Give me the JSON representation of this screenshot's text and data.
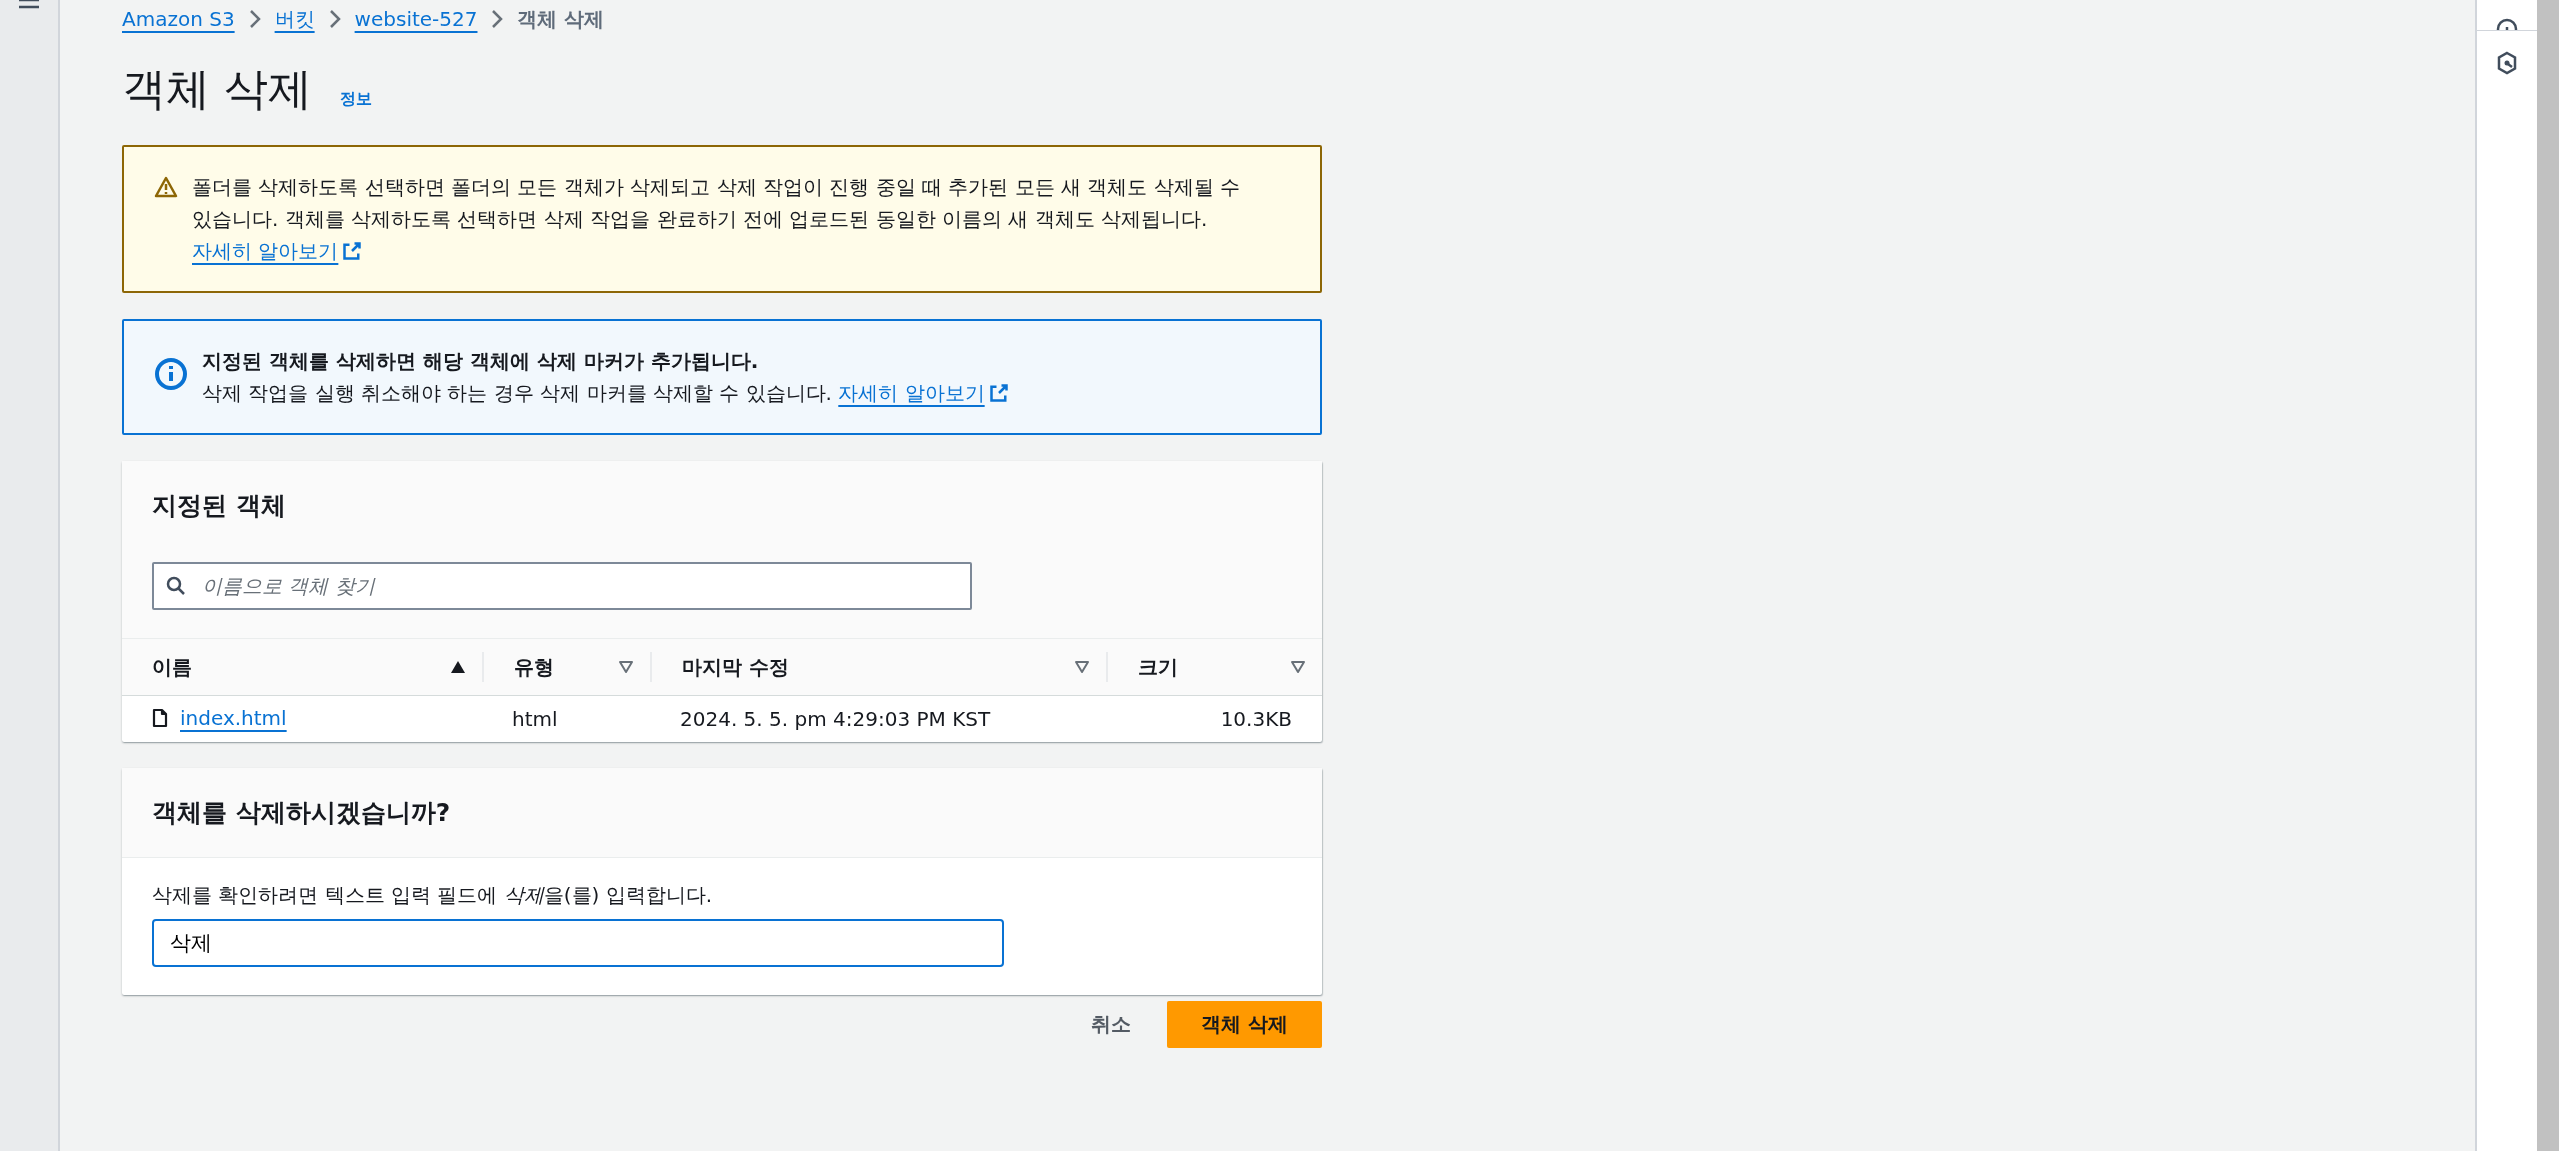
{
  "breadcrumbs": [
    {
      "label": "Amazon S3",
      "current": false
    },
    {
      "label": "버킷",
      "current": false
    },
    {
      "label": "website-527",
      "current": false
    },
    {
      "label": "객체 삭제",
      "current": true
    }
  ],
  "page_title": "객체 삭제",
  "info_link": "정보",
  "warning_alert": {
    "text": "폴더를 삭제하도록 선택하면 폴더의 모든 객체가 삭제되고 삭제 작업이 진행 중일 때 추가된 모든 새 객체도 삭제될 수 있습니다. 객체를 삭제하도록 선택하면 삭제 작업을 완료하기 전에 업로드된 동일한 이름의 새 객체도 삭제됩니다.",
    "link": "자세히 알아보기"
  },
  "info_alert": {
    "heading": "지정된 객체를 삭제하면 해당 객체에 삭제 마커가 추가됩니다.",
    "text": "삭제 작업을 실행 취소해야 하는 경우 삭제 마커를 삭제할 수 있습니다.",
    "link": "자세히 알아보기"
  },
  "objects_panel": {
    "title": "지정된 객체",
    "search": {
      "placeholder": "이름으로 객체 찾기"
    },
    "columns": [
      {
        "label": "이름",
        "sorted": true
      },
      {
        "label": "유형",
        "sorted": false
      },
      {
        "label": "마지막 수정",
        "sorted": false
      },
      {
        "label": "크기",
        "sorted": false
      }
    ],
    "rows": [
      {
        "name": "index.html",
        "type": "html",
        "last_modified": "2024. 5. 5. pm 4:29:03 PM KST",
        "size": "10.3KB"
      }
    ]
  },
  "confirm_panel": {
    "title": "객체를 삭제하시겠습니까?",
    "instruction": {
      "before": "삭제를 확인하려면 텍스트 입력 필드에 ",
      "emphasis": "삭제",
      "after": "을(를) 입력합니다."
    },
    "input": {
      "value": "삭제",
      "focused": true
    }
  },
  "buttons": [
    {
      "label": "취소",
      "kind": "link"
    },
    {
      "label": "객체 삭제",
      "kind": "primary"
    }
  ]
}
